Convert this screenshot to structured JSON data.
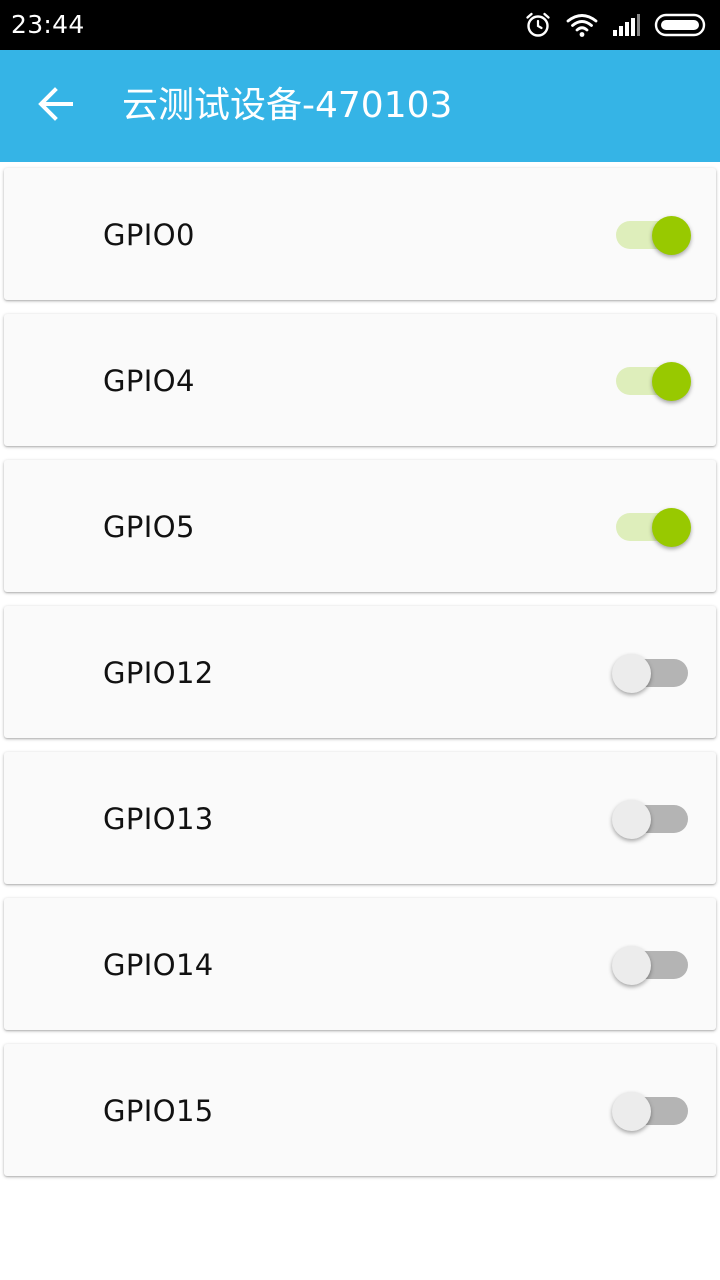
{
  "status_bar": {
    "time": "23:44",
    "icons": [
      "alarm-icon",
      "wifi-icon",
      "signal-icon",
      "battery-icon"
    ]
  },
  "app_bar": {
    "back_icon": "arrow-left-icon",
    "title": "云测试设备-470103",
    "color": "#35b4e6"
  },
  "gpios": [
    {
      "label": "GPIO0",
      "on": true
    },
    {
      "label": "GPIO4",
      "on": true
    },
    {
      "label": "GPIO5",
      "on": true
    },
    {
      "label": "GPIO12",
      "on": false
    },
    {
      "label": "GPIO13",
      "on": false
    },
    {
      "label": "GPIO14",
      "on": false
    },
    {
      "label": "GPIO15",
      "on": false
    }
  ],
  "colors": {
    "switch_on_thumb": "#98c900",
    "switch_on_track": "#deeebb",
    "switch_off_thumb": "#ececec",
    "switch_off_track": "#b4b4b4"
  }
}
